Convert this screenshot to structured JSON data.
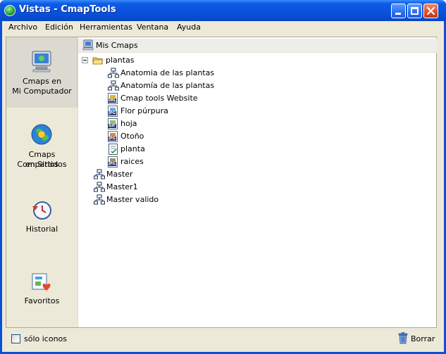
{
  "window": {
    "title": "Vistas - CmapTools"
  },
  "menu": [
    "Archivo",
    "Edición",
    "Herramientas",
    "Ventana",
    "Ayuda"
  ],
  "sidebar": {
    "items": [
      {
        "line1": "Cmaps en",
        "line2": "Mi Computador",
        "icon": "computer-icon",
        "selected": true
      },
      {
        "line1": "Cmaps Compartidos",
        "line2": "en Sitios",
        "icon": "shared-sites-icon",
        "selected": false
      },
      {
        "line1": "Historial",
        "line2": "",
        "icon": "history-icon",
        "selected": false
      },
      {
        "line1": "Favoritos",
        "line2": "",
        "icon": "favorites-icon",
        "selected": false
      }
    ]
  },
  "tree": {
    "root": "Mis Cmaps",
    "folder": "plantas",
    "folder_children": [
      {
        "label": "Anatomia de las plantas",
        "icon": "cmap-icon"
      },
      {
        "label": "Anatomía de las plantas",
        "icon": "cmap-icon"
      },
      {
        "label": "Cmap tools Website",
        "icon": "url-file-icon",
        "badge": "URL"
      },
      {
        "label": "Flor púrpura",
        "icon": "jpg-file-icon",
        "badge": "JPG"
      },
      {
        "label": "hoja",
        "icon": "gif-file-icon",
        "badge": "GIF"
      },
      {
        "label": "Otoño",
        "icon": "jpg-file-icon",
        "badge": "JPG"
      },
      {
        "label": "planta",
        "icon": "doc-file-icon",
        "badge": ""
      },
      {
        "label": "raices",
        "icon": "jpg-file-icon",
        "badge": "JPG"
      }
    ],
    "top_items": [
      {
        "label": "Master",
        "icon": "cmap-icon"
      },
      {
        "label": "Master1",
        "icon": "cmap-icon"
      },
      {
        "label": "Master valido",
        "icon": "cmap-icon"
      }
    ]
  },
  "status": {
    "checkbox_label": "sólo iconos",
    "delete_label": "Borrar"
  }
}
